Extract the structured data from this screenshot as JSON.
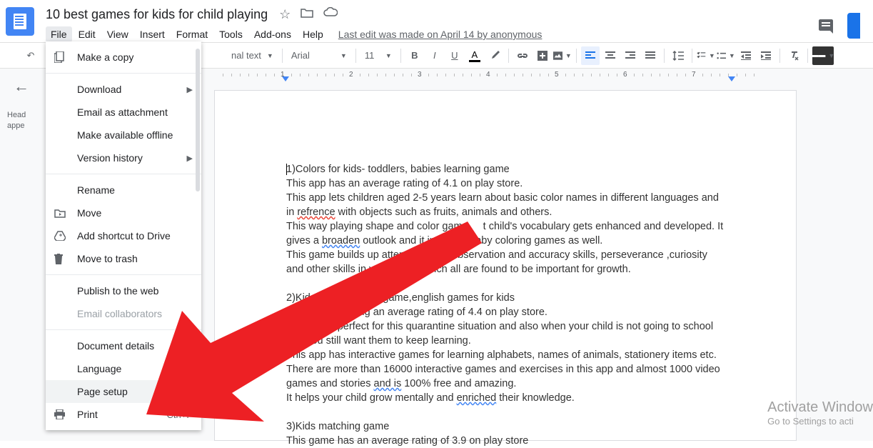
{
  "header": {
    "doc_title": "10 best games for kids for child playing",
    "last_edit": "Last edit was made on April 14 by anonymous"
  },
  "menu": {
    "file": "File",
    "edit": "Edit",
    "view": "View",
    "insert": "Insert",
    "format": "Format",
    "tools": "Tools",
    "addons": "Add-ons",
    "help": "Help"
  },
  "toolbar": {
    "style_select_suffix": "nal text",
    "font_select": "Arial",
    "font_size": "11"
  },
  "outline": {
    "line1": "Head",
    "line2": "appe"
  },
  "ruler": {
    "nums": [
      "1",
      "2",
      "3",
      "4",
      "5",
      "6",
      "7"
    ]
  },
  "file_menu": {
    "make_copy": "Make a copy",
    "download": "Download",
    "email_attachment": "Email as attachment",
    "available_offline": "Make available offline",
    "version_history": "Version history",
    "rename": "Rename",
    "move": "Move",
    "add_shortcut": "Add shortcut to Drive",
    "move_trash": "Move to trash",
    "publish_web": "Publish to the web",
    "email_collab": "Email collaborators",
    "doc_details": "Document details",
    "language": "Language",
    "page_setup": "Page setup",
    "print": "Print",
    "print_shortcut": "Ctrl+P"
  },
  "document": {
    "p1a": "1)Colors for kids- toddlers, babies learning game",
    "p1b": "This app has an average rating of 4.1 on play store.",
    "p1c_a": "This app lets children aged 2-5 years learn about basic color names in different languages and in ",
    "p1c_spell": "refrence",
    "p1c_b": " with objects such as fruits, animals and others.",
    "p1d_a": "This way playing shape and color gam",
    "p1d_b": "t child's vocabulary gets enhanced and developed. It gives a ",
    "p1d_spell": "broaden",
    "p1d_c": " outlook and it in",
    "p1d_d": "es baby coloring games as well.",
    "p1e_a": "This game builds up atten",
    "p1e_b": "ss, observation and accuracy skills, perseverance ,curiosity and other skills in your ch",
    "p1e_c": "ich all are found to be important for growth.",
    "blank": " ",
    "p2a": "2)Kids ed",
    "p2a_b": "nal game,english games for kids",
    "p2b_a": "Thi",
    "p2b_b": "s having an average rating of 4.4 on play store.",
    "p2c_a": "app is perfect for this quarantine situation and also when your child is not going to school and you still want them to keep learning.",
    "p2d": "This app has interactive games for learning alphabets, names of animals, stationery items etc.",
    "p2e_a": "There are more than 16000 interactive games and exercises in this app and almost 1000 video games and stories ",
    "p2e_spell": "and is",
    "p2e_b": " 100% free and amazing.",
    "p2f_a": "It helps your child grow mentally and ",
    "p2f_spell": "enriched",
    "p2f_b": " their knowledge.",
    "p3a": "3)Kids matching game",
    "p3b": "This game has an average rating of 3.9 on play store"
  },
  "watermark": {
    "title": "Activate Window",
    "subtitle": "Go to Settings to acti"
  }
}
